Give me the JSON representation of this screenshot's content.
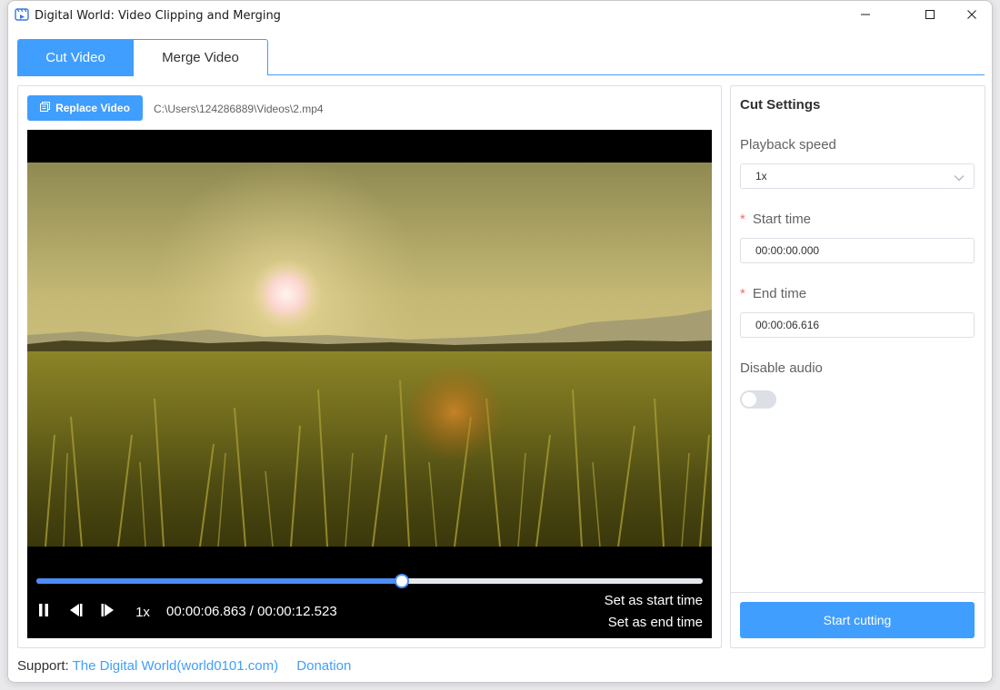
{
  "window": {
    "title": "Digital World: Video Clipping and Merging",
    "controls": [
      "minimize-icon",
      "maximize-icon",
      "close-icon"
    ]
  },
  "tabs": [
    {
      "label": "Cut Video",
      "active": true
    },
    {
      "label": "Merge Video",
      "active": false
    }
  ],
  "video_panel": {
    "replace_button": "Replace Video",
    "file_path": "C:\\Users\\124286889\\Videos\\2.mp4",
    "player": {
      "progress_fraction": 0.548,
      "speed": "1x",
      "time_readout": "00:00:06.863 / 00:00:12.523",
      "set_start_label": "Set as start time",
      "set_end_label": "Set as end time",
      "icons": [
        "pause-icon",
        "previous-frame-icon",
        "next-frame-icon"
      ]
    }
  },
  "cut_settings": {
    "title": "Cut Settings",
    "playback_speed_label": "Playback speed",
    "playback_speed_value": "1x",
    "start_time_label": "Start time",
    "start_time_value": "00:00:00.000",
    "end_time_label": "End time",
    "end_time_value": "00:00:06.616",
    "disable_audio_label": "Disable audio",
    "disable_audio_on": false,
    "required_mark": "*",
    "start_button": "Start cutting"
  },
  "footer": {
    "support_label": "Support:",
    "support_link": "The Digital World(world0101.com)",
    "donation_link": "Donation"
  },
  "colors": {
    "accent": "#409eff",
    "progress": "#4c8cf5",
    "required": "#f56c6c",
    "border": "#dcdfe6"
  }
}
